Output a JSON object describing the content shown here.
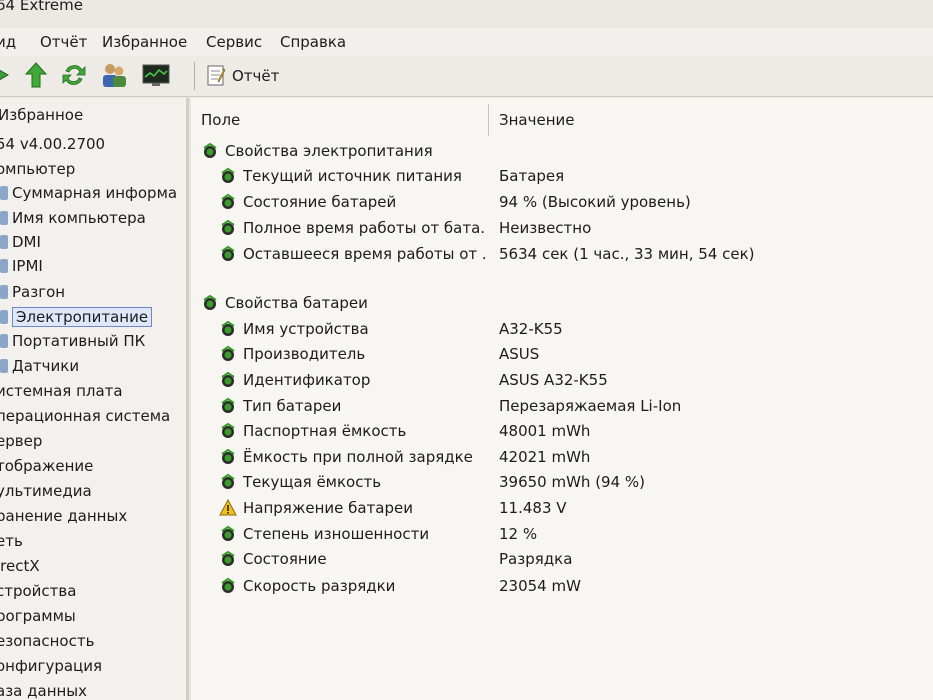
{
  "window": {
    "title": "64 Extreme"
  },
  "menu": [
    "ид",
    "Отчёт",
    "Избранное",
    "Сервис",
    "Справка"
  ],
  "toolbar": {
    "icons": [
      "forward-arrow-icon",
      "up-arrow-icon",
      "refresh-icon",
      "users-icon",
      "monitor-icon"
    ],
    "report_label": "Отчёт"
  },
  "sidebar": {
    "header": "Избранное",
    "items": [
      "54 v4.00.2700",
      "омпьютер",
      "Суммарная информа",
      "Имя компьютера",
      "DMI",
      "IPMI",
      "Разгон",
      "Электропитание",
      "Портативный ПК",
      "Датчики",
      "истемная плата",
      "перационная система",
      "ервер",
      "тображение",
      "ультимедиа",
      "ранение данных",
      "еть",
      "irectX",
      "стройства",
      "рограммы",
      "езопасность",
      "онфигурация",
      "аза данных"
    ]
  },
  "table": {
    "col_field": "Поле",
    "col_value": "Значение",
    "rows": [
      {
        "field": "Свойства электропитания",
        "value": ""
      },
      {
        "field": "Текущий источник питания",
        "value": "Батарея"
      },
      {
        "field": "Состояние батарей",
        "value": "94 % (Высокий уровень)"
      },
      {
        "field": "Полное время работы от бата...",
        "value": "Неизвестно"
      },
      {
        "field": "Оставшееся время работы от ...",
        "value": "5634 сек (1 час., 33 мин, 54 сек)"
      },
      {
        "field": "Свойства батареи",
        "value": ""
      },
      {
        "field": "Имя устройства",
        "value": "A32-K55"
      },
      {
        "field": "Производитель",
        "value": "ASUS"
      },
      {
        "field": "Идентификатор",
        "value": "ASUS A32-K55"
      },
      {
        "field": "Тип батареи",
        "value": "Перезаряжаемая Li-Ion"
      },
      {
        "field": "Паспортная ёмкость",
        "value": "48001 mWh"
      },
      {
        "field": "Ёмкость при полной зарядке",
        "value": "42021 mWh"
      },
      {
        "field": "Текущая ёмкость",
        "value": "39650 mWh  (94 %)"
      },
      {
        "field": "Напряжение батареи",
        "value": "11.483 V"
      },
      {
        "field": "Степень изношенности",
        "value": "12 %"
      },
      {
        "field": "Состояние",
        "value": "Разрядка"
      },
      {
        "field": "Скорость разрядки",
        "value": "23054 mW"
      }
    ]
  },
  "colors": {
    "selection_border": "#6f86c8",
    "icon_green": "#3a9a2a",
    "warning_yellow": "#f2c018"
  }
}
